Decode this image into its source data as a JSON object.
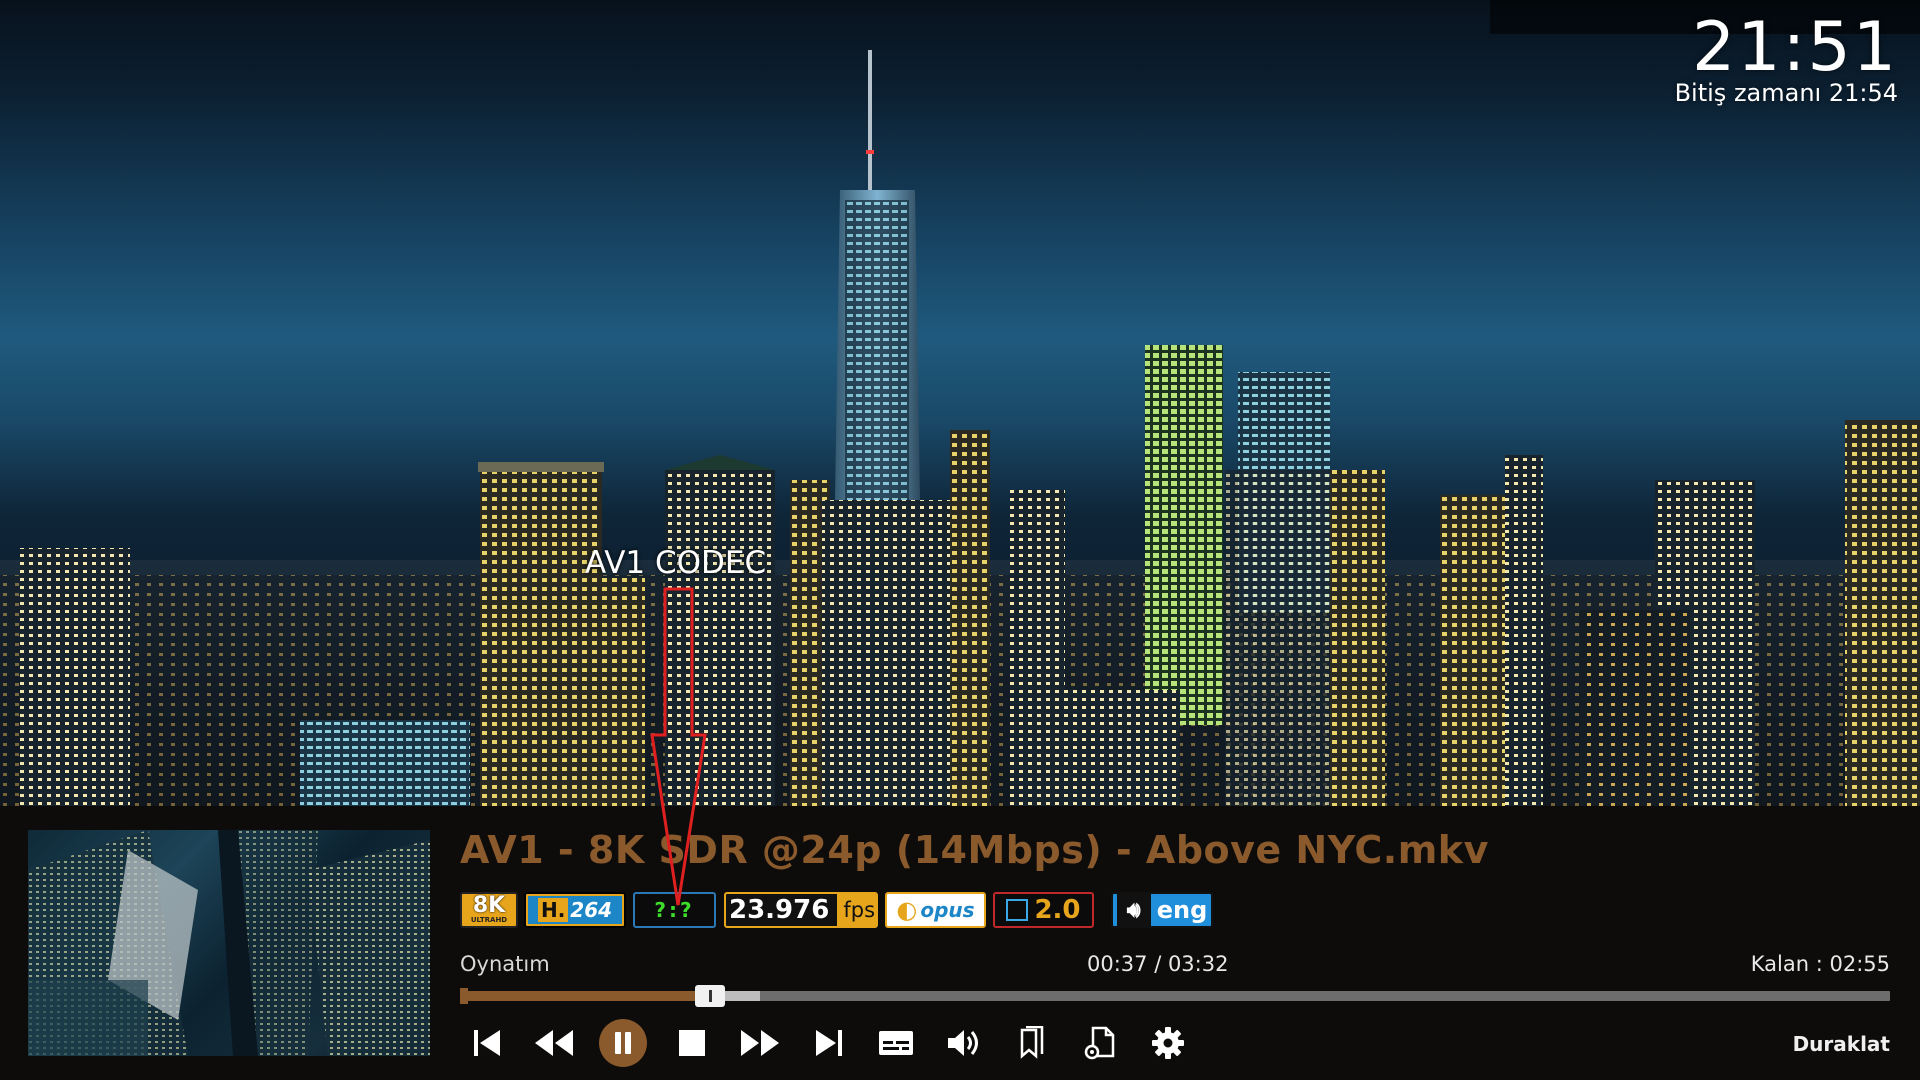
{
  "clock": {
    "time": "21:51",
    "end_time": "Bitiş zamanı 21:54"
  },
  "annotation": {
    "label": "AV1 CODEC",
    "arrow_color": "#e02020"
  },
  "now_playing": {
    "title": "AV1 - 8K SDR @24p (14Mbps) - Above NYC.mkv",
    "title_color": "#8a5a2c"
  },
  "media_flags": {
    "resolution": "8K",
    "resolution_sub": "ULTRAHD",
    "video_codec_prefix": "H.",
    "video_codec_number": "264",
    "aspect_ratio": "?:?",
    "fps_value": "23.976",
    "fps_unit": "fps",
    "audio_codec": "opus",
    "audio_channels": "2.0",
    "audio_language": "eng"
  },
  "progress": {
    "status_label": "Oynatım",
    "time": "00:37 / 03:32",
    "remaining": "Kalan : 02:55",
    "played_fraction": 0.175,
    "buffered_fraction": 0.21
  },
  "controls": {
    "state_label": "Duraklat",
    "buttons": [
      "skip-previous",
      "rewind",
      "pause",
      "stop",
      "fast-forward",
      "skip-next",
      "subtitles",
      "audio",
      "bookmarks",
      "video-settings",
      "settings"
    ]
  },
  "colors": {
    "accent": "#8a5a2c",
    "flag_gold": "#e7a51c",
    "flag_blue": "#1d86c7"
  }
}
